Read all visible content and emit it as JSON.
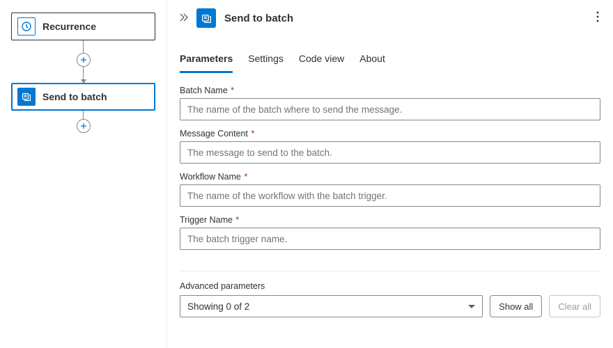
{
  "canvas": {
    "nodes": [
      {
        "label": "Recurrence",
        "icon": "clock-icon"
      },
      {
        "label": "Send to batch",
        "icon": "batch-icon"
      }
    ],
    "selected_index": 1
  },
  "panel": {
    "title": "Send to batch",
    "more_glyph": "⋮",
    "tabs": [
      "Parameters",
      "Settings",
      "Code view",
      "About"
    ],
    "active_tab": 0,
    "fields": [
      {
        "label": "Batch Name",
        "required": true,
        "placeholder": "The name of the batch where to send the message."
      },
      {
        "label": "Message Content",
        "required": true,
        "placeholder": "The message to send to the batch."
      },
      {
        "label": "Workflow Name",
        "required": true,
        "placeholder": "The name of the workflow with the batch trigger."
      },
      {
        "label": "Trigger Name",
        "required": true,
        "placeholder": "The batch trigger name."
      }
    ],
    "advanced": {
      "label": "Advanced parameters",
      "select_value": "Showing 0 of 2",
      "show_all": "Show all",
      "clear_all": "Clear all"
    }
  }
}
